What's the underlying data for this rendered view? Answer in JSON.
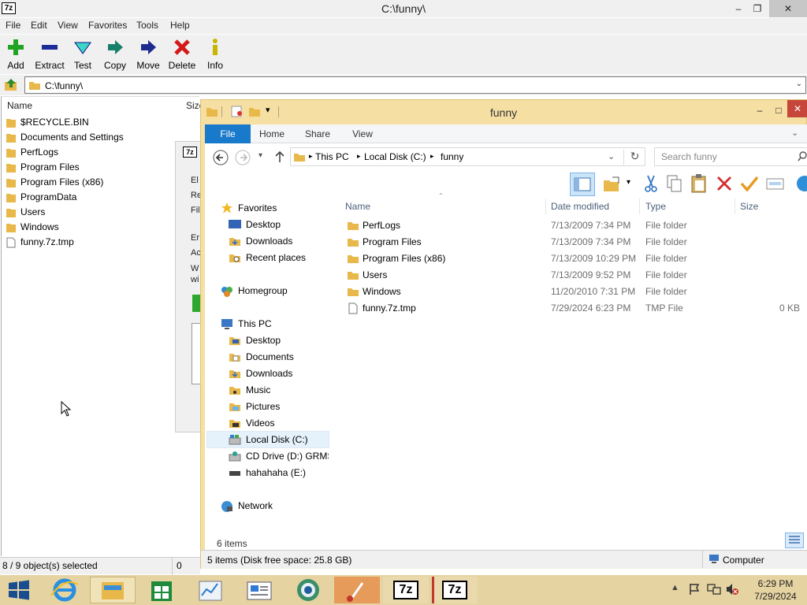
{
  "sz": {
    "title": "C:\\funny\\",
    "icon_label": "7z",
    "menu": [
      "File",
      "Edit",
      "View",
      "Favorites",
      "Tools",
      "Help"
    ],
    "toolbar": [
      "Add",
      "Extract",
      "Test",
      "Copy",
      "Move",
      "Delete",
      "Info"
    ],
    "path": "C:\\funny\\",
    "col_name": "Name",
    "col_size": "Size",
    "items": [
      "$RECYCLE.BIN",
      "Documents and Settings",
      "PerfLogs",
      "Program Files",
      "Program Files (x86)",
      "ProgramData",
      "Users",
      "Windows",
      "funny.7z.tmp"
    ],
    "status_left": "8 / 9 object(s) selected",
    "status_right": "0"
  },
  "peek": {
    "title_icon": "7z",
    "labels": [
      "El",
      "Re",
      "Fil",
      "Er",
      "Ac",
      "W",
      "wi"
    ]
  },
  "ex": {
    "title": "funny",
    "tabs": [
      "File",
      "Home",
      "Share",
      "View"
    ],
    "crumbs": [
      "This PC",
      "Local Disk (C:)",
      "funny"
    ],
    "search_placeholder": "Search funny",
    "nav": {
      "favorites": "Favorites",
      "fav_items": [
        "Desktop",
        "Downloads",
        "Recent places"
      ],
      "homegroup": "Homegroup",
      "thispc": "This PC",
      "pc_items": [
        "Desktop",
        "Documents",
        "Downloads",
        "Music",
        "Pictures",
        "Videos",
        "Local Disk (C:)",
        "CD Drive (D:) GRMSX",
        "hahahaha (E:)"
      ],
      "network": "Network"
    },
    "columns": [
      "Name",
      "Date modified",
      "Type",
      "Size"
    ],
    "files": [
      {
        "name": "PerfLogs",
        "date": "7/13/2009 7:34 PM",
        "type": "File folder",
        "size": ""
      },
      {
        "name": "Program Files",
        "date": "7/13/2009 7:34 PM",
        "type": "File folder",
        "size": ""
      },
      {
        "name": "Program Files (x86)",
        "date": "7/13/2009 10:29 PM",
        "type": "File folder",
        "size": ""
      },
      {
        "name": "Users",
        "date": "7/13/2009 9:52 PM",
        "type": "File folder",
        "size": ""
      },
      {
        "name": "Windows",
        "date": "11/20/2010 7:31 PM",
        "type": "File folder",
        "size": ""
      },
      {
        "name": "funny.7z.tmp",
        "date": "7/29/2024 6:23 PM",
        "type": "TMP File",
        "size": "0 KB"
      }
    ],
    "item_count": "6 items",
    "status_left": "5 items (Disk free space: 25.8 GB)",
    "status_right": "Computer"
  },
  "taskbar": {
    "time": "6:29 PM",
    "date": "7/29/2024",
    "sz_label": "7z"
  },
  "colors": {
    "explorer_frame": "#f5dfa3",
    "ribbon_file_tab": "#1979ca",
    "taskbar": "#e6d3a2",
    "folder": "#e8b84a"
  }
}
